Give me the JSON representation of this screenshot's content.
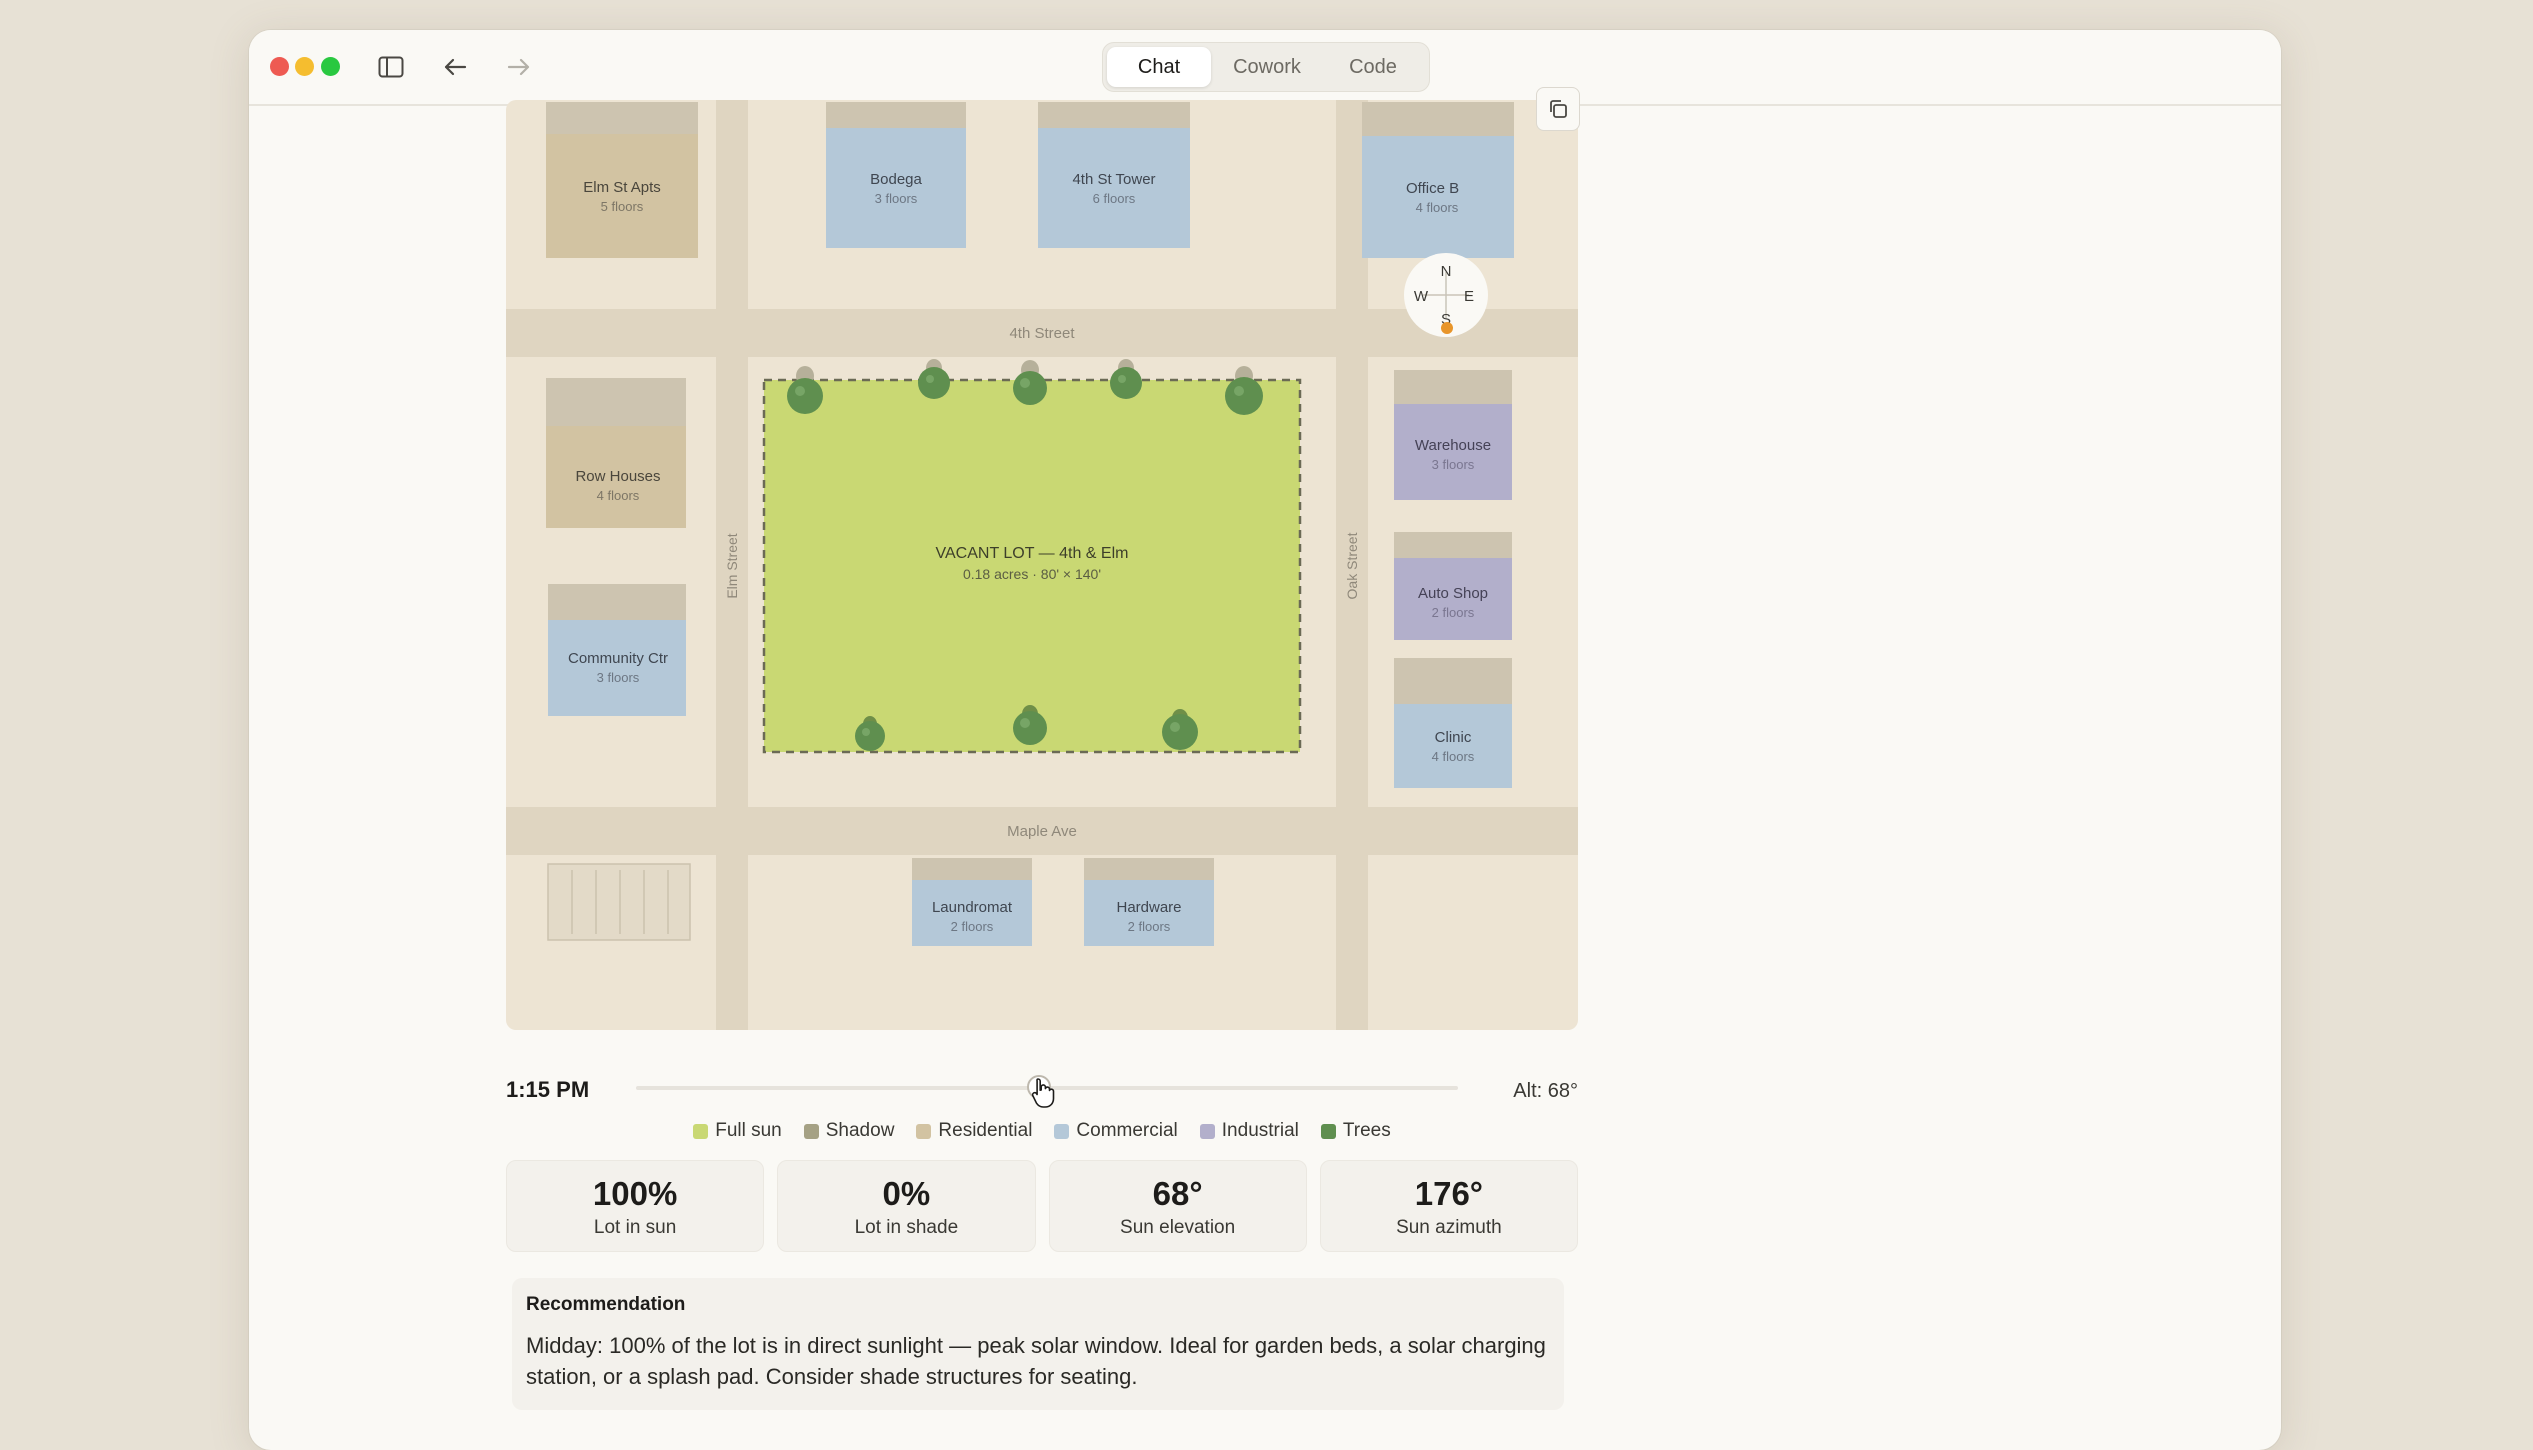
{
  "tabs": [
    {
      "label": "Chat",
      "active": true
    },
    {
      "label": "Cowork",
      "active": false
    },
    {
      "label": "Code",
      "active": false
    }
  ],
  "map": {
    "streets": {
      "top": "4th Street",
      "bottom": "Maple Ave",
      "left": "Elm Street",
      "right": "Oak Street"
    },
    "lot": {
      "title": "VACANT LOT — 4th & Elm",
      "subtitle": "0.18 acres · 80' × 140'"
    },
    "buildings": [
      {
        "name": "Elm St Apts",
        "floors": "5 floors",
        "type": "residential"
      },
      {
        "name": "Bodega",
        "floors": "3 floors",
        "type": "commercial"
      },
      {
        "name": "4th St Tower",
        "floors": "6 floors",
        "type": "commercial"
      },
      {
        "name": "Office B",
        "floors": "4 floors",
        "type": "commercial"
      },
      {
        "name": "Row Houses",
        "floors": "4 floors",
        "type": "residential"
      },
      {
        "name": "Community Ctr",
        "floors": "3 floors",
        "type": "commercial"
      },
      {
        "name": "Warehouse",
        "floors": "3 floors",
        "type": "industrial"
      },
      {
        "name": "Auto Shop",
        "floors": "2 floors",
        "type": "industrial"
      },
      {
        "name": "Clinic",
        "floors": "4 floors",
        "type": "commercial"
      },
      {
        "name": "Laundromat",
        "floors": "2 floors",
        "type": "commercial"
      },
      {
        "name": "Hardware",
        "floors": "2 floors",
        "type": "commercial"
      }
    ],
    "compass": {
      "n": "N",
      "s": "S",
      "e": "E",
      "w": "W"
    }
  },
  "controls": {
    "time": "1:15 PM",
    "altitude": "Alt: 68°",
    "slider_position": 0.49
  },
  "legend": [
    {
      "label": "Full sun",
      "color": "#c9d873"
    },
    {
      "label": "Shadow",
      "color": "#a5a184"
    },
    {
      "label": "Residential",
      "color": "#d2c3a2"
    },
    {
      "label": "Commercial",
      "color": "#b4c8d8"
    },
    {
      "label": "Industrial",
      "color": "#b2afcb"
    },
    {
      "label": "Trees",
      "color": "#5f8f4f"
    }
  ],
  "stats": [
    {
      "value": "100%",
      "label": "Lot in sun"
    },
    {
      "value": "0%",
      "label": "Lot in shade"
    },
    {
      "value": "68°",
      "label": "Sun elevation"
    },
    {
      "value": "176°",
      "label": "Sun azimuth"
    }
  ],
  "recommendation": {
    "title": "Recommendation",
    "text": "Midday: 100% of the lot is in direct sunlight — peak solar window. Ideal for garden beds, a solar charging station, or a splash pad. Consider shade structures for seating."
  }
}
